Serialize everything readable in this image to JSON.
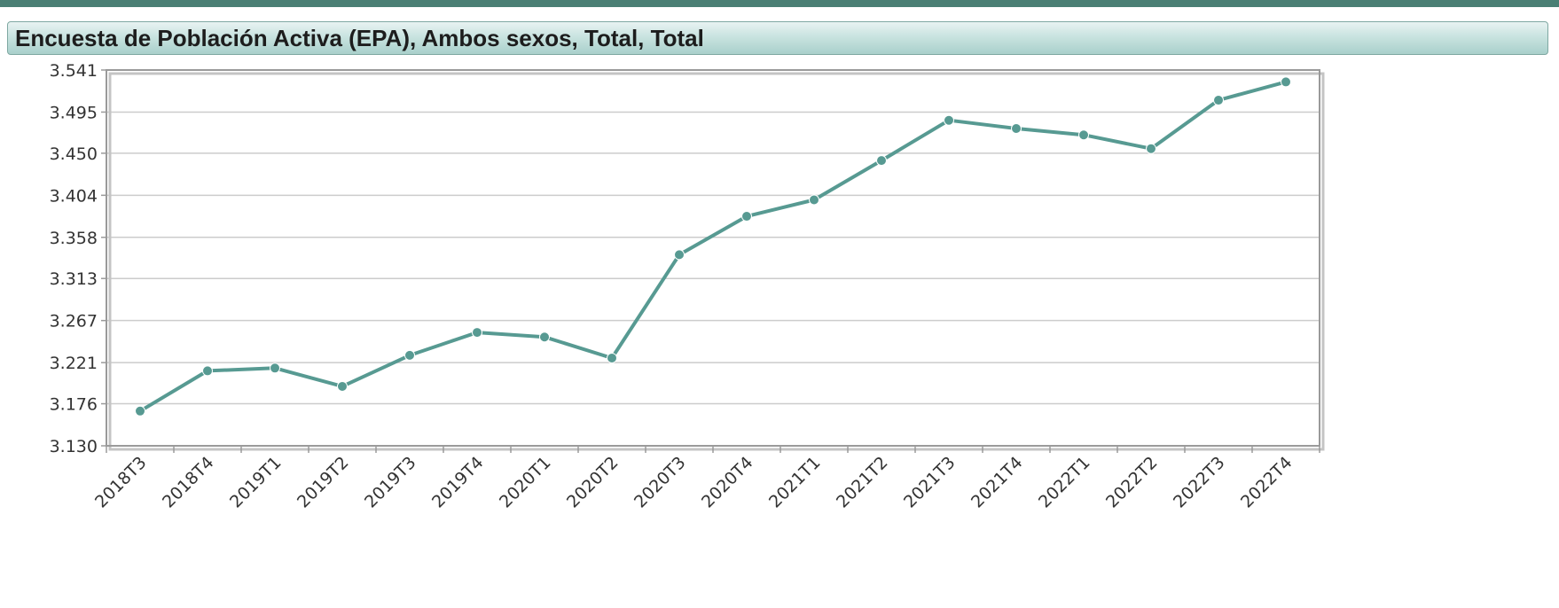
{
  "title": "Encuesta de Población Activa (EPA), Ambos sexos, Total, Total",
  "colors": {
    "line": "#579a92",
    "grid": "#cccccc",
    "frame": "#9a9a9a",
    "header": "#a9d0cb"
  },
  "chart_data": {
    "type": "line",
    "title": "Encuesta de Población Activa (EPA), Ambos sexos, Total, Total",
    "xlabel": "",
    "ylabel": "",
    "grid": true,
    "ylim": [
      3130,
      3541
    ],
    "y_ticks": [
      3130,
      3176,
      3221,
      3267,
      3313,
      3358,
      3404,
      3450,
      3495,
      3541
    ],
    "y_tick_labels": [
      "3.130",
      "3.176",
      "3.221",
      "3.267",
      "3.313",
      "3.358",
      "3.404",
      "3.450",
      "3.495",
      "3.541"
    ],
    "categories": [
      "2018T3",
      "2018T4",
      "2019T1",
      "2019T2",
      "2019T3",
      "2019T4",
      "2020T1",
      "2020T2",
      "2020T3",
      "2020T4",
      "2021T1",
      "2021T2",
      "2021T3",
      "2021T4",
      "2022T1",
      "2022T2",
      "2022T3",
      "2022T4"
    ],
    "series": [
      {
        "values": [
          3168,
          3212,
          3215,
          3195,
          3229,
          3254,
          3249,
          3226,
          3339,
          3381,
          3399,
          3442,
          3486,
          3477,
          3470,
          3455,
          3508,
          3528
        ]
      }
    ]
  }
}
